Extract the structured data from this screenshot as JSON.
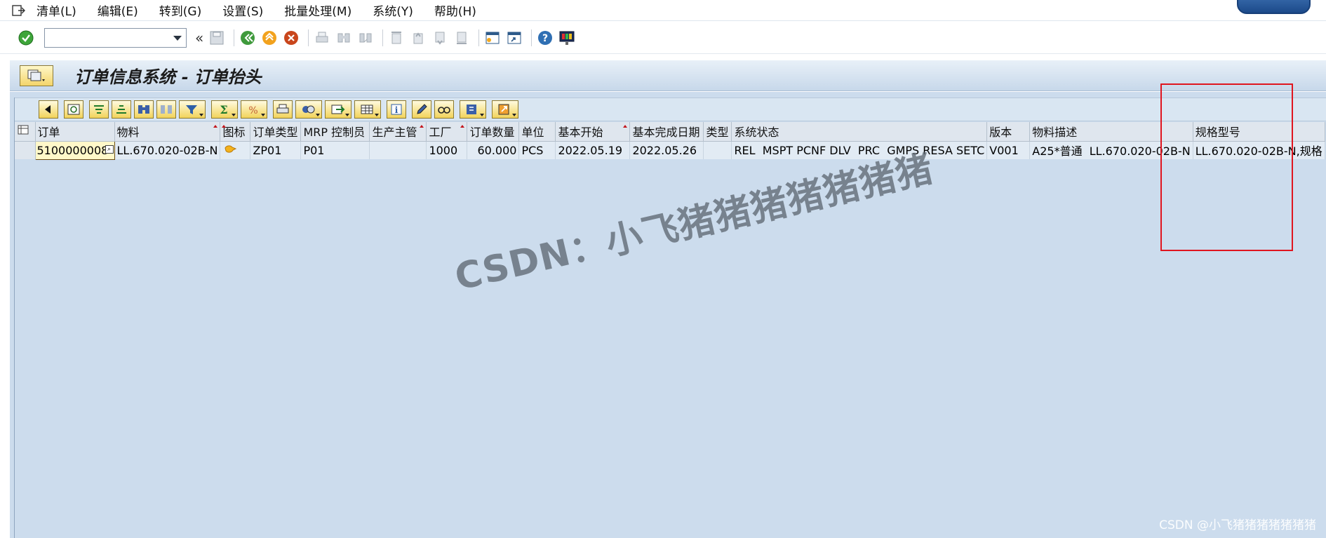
{
  "menubar": {
    "items": [
      "清单(L)",
      "编辑(E)",
      "转到(G)",
      "设置(S)",
      "批量处理(M)",
      "系统(Y)",
      "帮助(H)"
    ]
  },
  "toolbar": {
    "command_value": "",
    "back_glyph": "«"
  },
  "title": {
    "text": "订单信息系统 - 订单抬头"
  },
  "grid": {
    "headers": [
      "订单",
      "物料",
      "图标",
      "订单类型",
      "MRP 控制员",
      "生产主管",
      "工厂",
      "订单数量",
      "单位",
      "基本开始",
      "基本完成日期",
      "类型",
      "系统状态",
      "版本",
      "物料描述",
      "规格型号"
    ],
    "row": {
      "order": "5100000008",
      "material": "LL.670.020-02B-N",
      "icon": "",
      "order_type": "ZP01",
      "mrp_controller": "P01",
      "prod_supervisor": "",
      "plant": "1000",
      "quantity": "60.000",
      "unit": "PCS",
      "basic_start": "2022.05.19",
      "basic_finish": "2022.05.26",
      "type": "",
      "system_status": "REL  MSPT PCNF DLV  PRC  GMPS RESA SETC",
      "version": "V001",
      "material_desc": "A25*普通  LL.670.020-02B-N",
      "spec_model": "LL.670.020-02B-N,规格"
    }
  },
  "watermark": {
    "main": "CSDN：小飞猪猪猪猪猪猪猪",
    "corner": "CSDN @小飞猪猪猪猪猪猪猪"
  },
  "colors": {
    "background": "#ccdced",
    "highlight": "#e0151f",
    "button_yellow": "#f2d35a"
  }
}
